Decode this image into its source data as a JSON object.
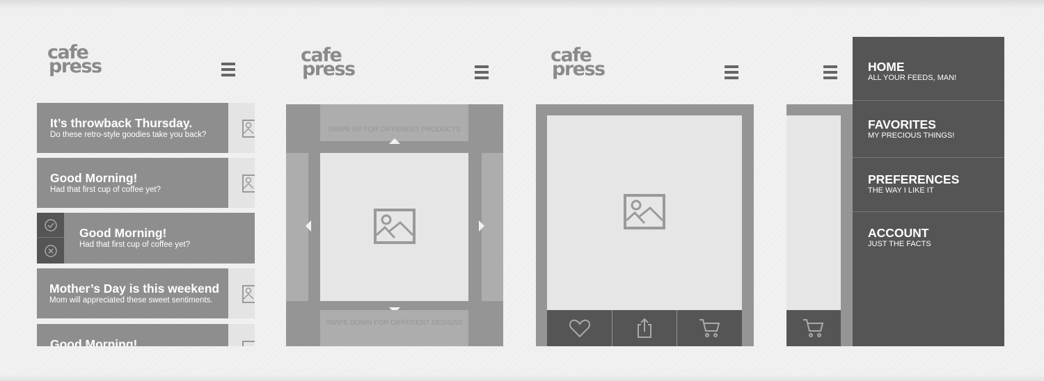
{
  "logo": {
    "line1": "cafe",
    "line2": "press"
  },
  "feed": {
    "cards": [
      {
        "title": "It’s throwback Thursday.",
        "subtitle": "Do these retro-style goodies take you back?"
      },
      {
        "title": "Good Morning!",
        "subtitle": "Had that first cup of coffee yet?"
      },
      {
        "title": "Good Morning!",
        "subtitle": "Had that first cup of coffee yet?"
      },
      {
        "title": "Mother’s Day is this weekend",
        "subtitle": "Mom will appreciated these sweet sentiments."
      },
      {
        "title": "Good Morning!",
        "subtitle": ""
      }
    ]
  },
  "swipe": {
    "up": "SWIPE UP FOR DIFFERENT PRODUCTS",
    "down": "SWIPE DOWN FOR DIFFERENT DESIGNS"
  },
  "product": {
    "actions": [
      "heart-icon",
      "share-icon",
      "cart-icon"
    ]
  },
  "menu": {
    "items": [
      {
        "title": "HOME",
        "subtitle": "ALL YOUR FEEDS, MAN!"
      },
      {
        "title": "FAVORITES",
        "subtitle": "MY PRECIOUS THINGS!"
      },
      {
        "title": "PREFERENCES",
        "subtitle": "THE WAY I LIKE IT"
      },
      {
        "title": "ACCOUNT",
        "subtitle": "JUST THE FACTS"
      }
    ]
  },
  "colors": {
    "card": "#8e8e8e",
    "dark": "#555555",
    "image": "#e6e6e6",
    "frame": "#959595"
  }
}
